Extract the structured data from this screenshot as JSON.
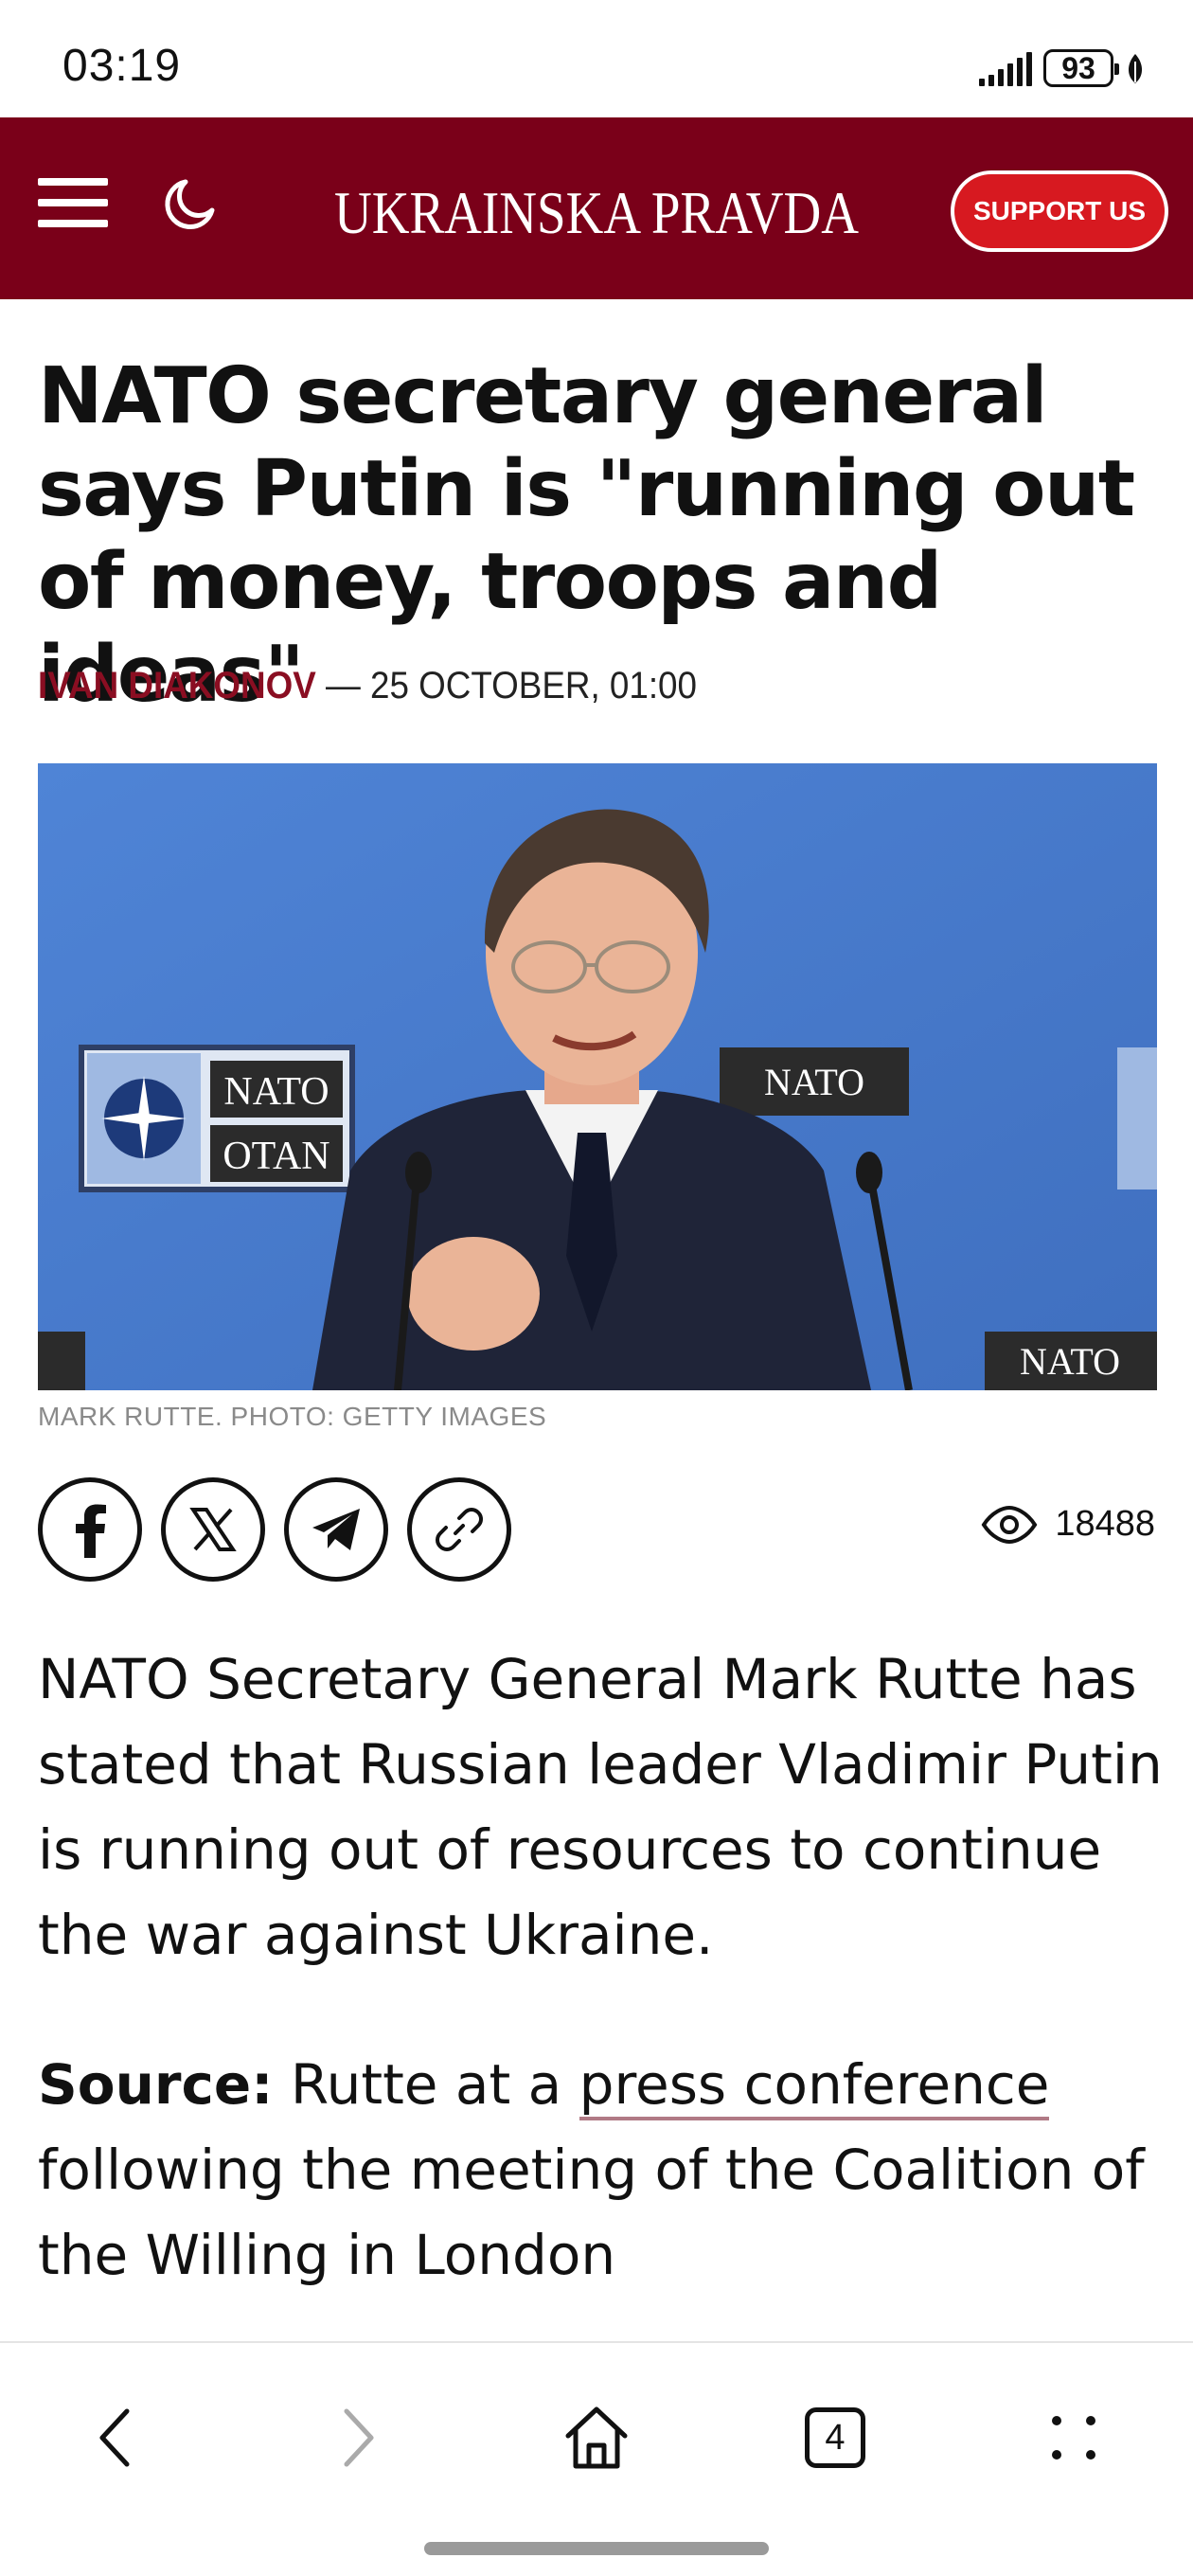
{
  "status_bar": {
    "time": "03:19",
    "battery": "93",
    "icons": [
      "signal-icon",
      "battery-icon",
      "leaf-icon"
    ]
  },
  "header": {
    "site_name": "UKRAINSKA PRAVDA",
    "support_label": "SUPPORT US",
    "icons": [
      "menu-icon",
      "moon-icon"
    ],
    "brand_color": "#7a0019",
    "support_color": "#d71920"
  },
  "article": {
    "title": "NATO secretary general says Putin is \"running out of money, troops and ideas\"",
    "author": "IVAN DIAKONOV",
    "date_separator": " — ",
    "date": "25 OCTOBER, 01:00",
    "photo_caption": "MARK RUTTE. PHOTO: GETTY IMAGES",
    "photo_signs": [
      "NATO",
      "OTAN",
      "NATO",
      "NATO"
    ],
    "views": "18488",
    "share_icons": [
      "facebook-icon",
      "x-icon",
      "telegram-icon",
      "link-icon"
    ],
    "paragraph_1": "NATO Secretary General Mark Rutte has stated that Russian leader Vladimir Putin is running out of resources to continue the war against Ukraine.",
    "source_label": "Source:",
    "source_prefix": " Rutte at a ",
    "source_link": "press conference",
    "source_suffix": " following the meeting of the Coalition of the Willing in London"
  },
  "bottom_nav": {
    "tab_count": "4",
    "icons": [
      "back-icon",
      "forward-icon",
      "home-icon",
      "tabs-icon",
      "more-icon"
    ]
  }
}
